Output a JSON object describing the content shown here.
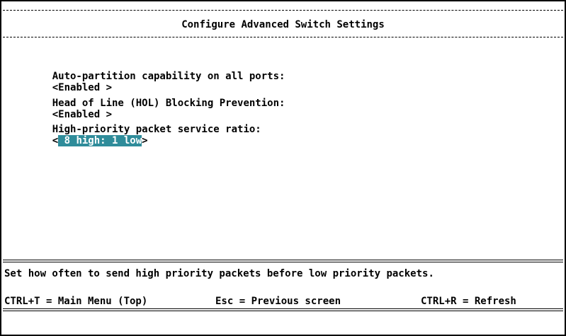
{
  "screen": {
    "title": "Configure Advanced Switch Settings"
  },
  "settings": [
    {
      "label": "Auto-partition capability on all ports:",
      "open": "<",
      "value": "Enabled ",
      "close": ">"
    },
    {
      "label": "Head of Line (HOL) Blocking Prevention:",
      "open": "<",
      "value": "Enabled ",
      "close": ">"
    },
    {
      "label": "High-priority packet service ratio:",
      "open": "<",
      "value": " 8 high: 1 low",
      "close": ">"
    }
  ],
  "help_text": "Set how often to send high priority packets before low priority packets.",
  "footer": {
    "main_menu": "CTRL+T = Main Menu (Top)",
    "previous": "Esc = Previous screen",
    "refresh": "CTRL+R = Refresh"
  },
  "colors": {
    "selection_background": "#2f8c9a",
    "selection_text": "#ffffff",
    "text": "#000000",
    "background": "#ffffff"
  }
}
